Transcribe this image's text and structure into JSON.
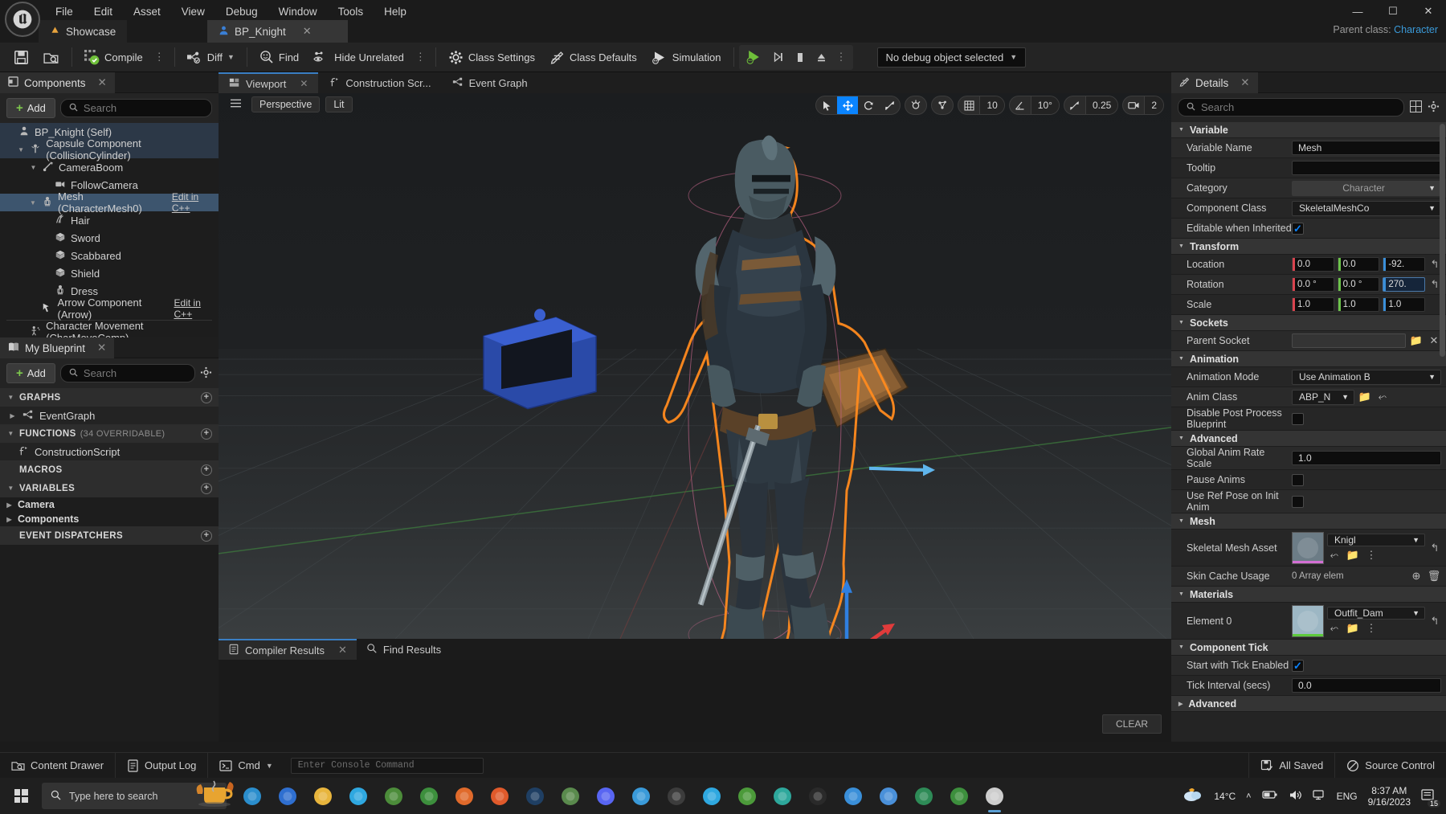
{
  "window": {
    "menu": [
      "File",
      "Edit",
      "Asset",
      "View",
      "Debug",
      "Window",
      "Tools",
      "Help"
    ],
    "minimize": "—",
    "maximize": "☐",
    "close": "✕",
    "parent_class_label": "Parent class:",
    "parent_class_value": "Character"
  },
  "tabs": {
    "inactive": "Showcase",
    "active": "BP_Knight",
    "close": "✕"
  },
  "toolbar": {
    "save_icon": "save-icon",
    "browse_icon": "browse-icon",
    "compile": "Compile",
    "diff": "Diff",
    "find": "Find",
    "hide_unrelated": "Hide Unrelated",
    "class_settings": "Class Settings",
    "class_defaults": "Class Defaults",
    "simulation": "Simulation",
    "debug_object": "No debug object selected",
    "dots": "⋮"
  },
  "components_panel": {
    "title": "Components",
    "close": "✕",
    "add_label": "Add",
    "search_placeholder": "Search",
    "tree": [
      {
        "label": "BP_Knight (Self)",
        "indent": 0,
        "icon": "actor-icon",
        "arrow": "",
        "state": "root"
      },
      {
        "label": "Capsule Component (CollisionCylinder)",
        "indent": 1,
        "icon": "capsule-icon",
        "arrow": "▼",
        "state": "root"
      },
      {
        "label": "CameraBoom",
        "indent": 2,
        "icon": "springarm-icon",
        "arrow": "▼",
        "state": ""
      },
      {
        "label": "FollowCamera",
        "indent": 3,
        "icon": "camera-icon",
        "arrow": "",
        "state": ""
      },
      {
        "label": "Mesh (CharacterMesh0)",
        "indent": 2,
        "icon": "skeletalmesh-icon",
        "arrow": "▼",
        "state": "selected",
        "edit": "Edit in C++"
      },
      {
        "label": "Hair",
        "indent": 3,
        "icon": "groom-icon",
        "arrow": "",
        "state": ""
      },
      {
        "label": "Sword",
        "indent": 3,
        "icon": "staticmesh-icon",
        "arrow": "",
        "state": ""
      },
      {
        "label": "Scabbared",
        "indent": 3,
        "icon": "staticmesh-icon",
        "arrow": "",
        "state": ""
      },
      {
        "label": "Shield",
        "indent": 3,
        "icon": "staticmesh-icon",
        "arrow": "",
        "state": ""
      },
      {
        "label": "Dress",
        "indent": 3,
        "icon": "skeletalmesh-icon",
        "arrow": "",
        "state": ""
      },
      {
        "label": "Arrow Component (Arrow)",
        "indent": 2,
        "icon": "arrow-icon",
        "arrow": "",
        "state": "",
        "edit": "Edit in C++"
      },
      {
        "label": "Character Movement (CharMoveComp)",
        "indent": 1,
        "icon": "movement-icon",
        "arrow": "",
        "state": "",
        "divider": true
      }
    ]
  },
  "myblueprint_panel": {
    "title": "My Blueprint",
    "close": "✕",
    "add_label": "Add",
    "search_placeholder": "Search",
    "settings_icon": "gear-icon",
    "sections": [
      {
        "label": "GRAPHS",
        "sub": "",
        "arrow": "▼",
        "plus": "+"
      },
      {
        "label": "FUNCTIONS",
        "sub": "(34 OVERRIDABLE)",
        "arrow": "▼",
        "plus": "+"
      },
      {
        "label": "MACROS",
        "sub": "",
        "arrow": "",
        "plus": "+"
      },
      {
        "label": "VARIABLES",
        "sub": "",
        "arrow": "▼",
        "plus": "+"
      },
      {
        "label": "EVENT DISPATCHERS",
        "sub": "",
        "arrow": "",
        "plus": "+"
      }
    ],
    "graph_item": "EventGraph",
    "function_item": "ConstructionScript",
    "variables": [
      "Camera",
      "Components"
    ]
  },
  "viewport": {
    "tabs": [
      {
        "label": "Viewport",
        "icon": "viewport-icon",
        "active": true,
        "close": "✕"
      },
      {
        "label": "Construction Scr...",
        "icon": "function-icon",
        "active": false
      },
      {
        "label": "Event Graph",
        "icon": "eventgraph-icon",
        "active": false
      }
    ],
    "menu_icon": "hamburger-icon",
    "perspective": "Perspective",
    "lit": "Lit",
    "gizmos": [
      {
        "name": "select-tool",
        "glyph": "➤",
        "active": false
      },
      {
        "name": "move-tool",
        "glyph": "✥",
        "active": true
      },
      {
        "name": "rotate-tool",
        "glyph": "⟳",
        "active": false
      },
      {
        "name": "scale-tool",
        "glyph": "⤢",
        "active": false
      }
    ],
    "coord_icon": "world-coords-icon",
    "surface_snap_icon": "surface-snap-icon",
    "grid_snap_value": "10",
    "rotation_snap_value": "10°",
    "scale_snap_value": "0.25",
    "camera_speed_value": "2"
  },
  "bottom_panel": {
    "tabs": [
      {
        "label": "Compiler Results",
        "icon": "compiler-icon",
        "active": true,
        "close": "✕"
      },
      {
        "label": "Find Results",
        "icon": "search-icon",
        "active": false
      }
    ],
    "clear_label": "CLEAR"
  },
  "details_panel": {
    "title": "Details",
    "close": "✕",
    "search_placeholder": "Search",
    "grid_icon": "grid-view-icon",
    "settings_icon": "gear-icon",
    "categories": [
      {
        "name": "Variable",
        "rows": [
          {
            "label": "Variable Name",
            "type": "text",
            "value": "Mesh"
          },
          {
            "label": "Tooltip",
            "type": "text",
            "value": ""
          },
          {
            "label": "Category",
            "type": "dropdown-ro",
            "value": "Character"
          },
          {
            "label": "Component Class",
            "type": "dropdown",
            "value": "SkeletalMeshCo"
          },
          {
            "label": "Editable when Inherited",
            "type": "checkbox",
            "checked": true
          }
        ]
      },
      {
        "name": "Transform",
        "rows": [
          {
            "label": "Location",
            "type": "vector",
            "dropdown": "Location",
            "x": "0.0",
            "y": "0.0",
            "z": "-92.",
            "revert": "↰"
          },
          {
            "label": "Rotation",
            "type": "vector",
            "dropdown": "Rotation",
            "x": "0.0 °",
            "y": "0.0 °",
            "z": "270.",
            "selected": "z",
            "revert": "↰"
          },
          {
            "label": "Scale",
            "type": "vector",
            "dropdown": "Scale",
            "x": "1.0",
            "y": "1.0",
            "z": "1.0",
            "lock": "🔒"
          }
        ]
      },
      {
        "name": "Sockets",
        "rows": [
          {
            "label": "Parent Socket",
            "type": "socket",
            "value": "",
            "browse": "browse-icon",
            "clear": "✕"
          }
        ]
      },
      {
        "name": "Animation",
        "rows": [
          {
            "label": "Animation Mode",
            "type": "dropdown",
            "value": "Use Animation B"
          },
          {
            "label": "Anim Class",
            "type": "asset-dropdown",
            "value": "ABP_N"
          },
          {
            "label": "Disable Post Process Blueprint",
            "type": "checkbox",
            "checked": false
          }
        ]
      },
      {
        "name": "Advanced",
        "rows": [
          {
            "label": "Global Anim Rate Scale",
            "type": "text",
            "value": "1.0"
          },
          {
            "label": "Pause Anims",
            "type": "checkbox",
            "checked": false
          },
          {
            "label": "Use Ref Pose on Init Anim",
            "type": "checkbox",
            "checked": false
          }
        ]
      },
      {
        "name": "Mesh",
        "rows": [
          {
            "label": "Skeletal Mesh Asset",
            "type": "asset",
            "value": "Knigl",
            "thumb_color": "#6c7c86",
            "bar_color": "#d46fd4",
            "revert": "↰"
          },
          {
            "label": "Skin Cache Usage",
            "type": "array",
            "value": "0 Array elem",
            "add": "⊕",
            "delete": "🗑"
          }
        ]
      },
      {
        "name": "Materials",
        "rows": [
          {
            "label": "Element 0",
            "type": "asset",
            "value": "Outfit_Dam",
            "thumb_color": "#9db7c4",
            "bar_color": "#5ecb3c",
            "revert": "↰"
          }
        ]
      },
      {
        "name": "Component Tick",
        "rows": [
          {
            "label": "Start with Tick Enabled",
            "type": "checkbox",
            "checked": true
          },
          {
            "label": "Tick Interval (secs)",
            "type": "text",
            "value": "0.0"
          }
        ]
      },
      {
        "name": "Advanced2",
        "display_name": "Advanced",
        "collapsed": true,
        "rows": []
      }
    ]
  },
  "status_bar": {
    "content_drawer": "Content Drawer",
    "output_log": "Output Log",
    "cmd": "Cmd",
    "console_placeholder": "Enter Console Command",
    "all_saved": "All Saved",
    "source_control": "Source Control"
  },
  "taskbar": {
    "search_placeholder": "Type here to search",
    "temperature": "14°C",
    "language": "ENG",
    "time": "8:37 AM",
    "date": "9/16/2023",
    "notification_count": "15",
    "apps": [
      {
        "name": "edge-icon",
        "color": "#2b8ecd"
      },
      {
        "name": "opera-icon",
        "color": "#2f6fd0"
      },
      {
        "name": "file-explorer-icon",
        "color": "#e8b53d"
      },
      {
        "name": "telegram-icon",
        "color": "#2fa8e0"
      },
      {
        "name": "dolphin-icon",
        "color": "#4c8c3a"
      },
      {
        "name": "chrome-icon",
        "color": "#3d8f3d"
      },
      {
        "name": "firefox-icon",
        "color": "#e06a2b"
      },
      {
        "name": "vlc-icon",
        "color": "#e05a2b"
      },
      {
        "name": "photoshop-icon",
        "color": "#1f3f63"
      },
      {
        "name": "box-icon",
        "color": "#5a8a4d"
      },
      {
        "name": "discord-icon",
        "color": "#5865f2"
      },
      {
        "name": "bitcoin-icon",
        "color": "#3a9ad9"
      },
      {
        "name": "terminal-icon",
        "color": "#3c3c3c"
      },
      {
        "name": "twitter-icon",
        "color": "#2fa8e0"
      },
      {
        "name": "xbox-icon",
        "color": "#4c9a3a"
      },
      {
        "name": "teal-app-icon",
        "color": "#2ea89c"
      },
      {
        "name": "epic-games-icon",
        "color": "#2a2a2a"
      },
      {
        "name": "quixel-icon",
        "color": "#3a8fd9"
      },
      {
        "name": "maya-icon",
        "color": "#4a90d9"
      },
      {
        "name": "excel-icon",
        "color": "#2e8b57"
      },
      {
        "name": "chrome2-icon",
        "color": "#3d8f3d"
      },
      {
        "name": "unreal-icon",
        "color": "#cdcdcd"
      }
    ]
  }
}
